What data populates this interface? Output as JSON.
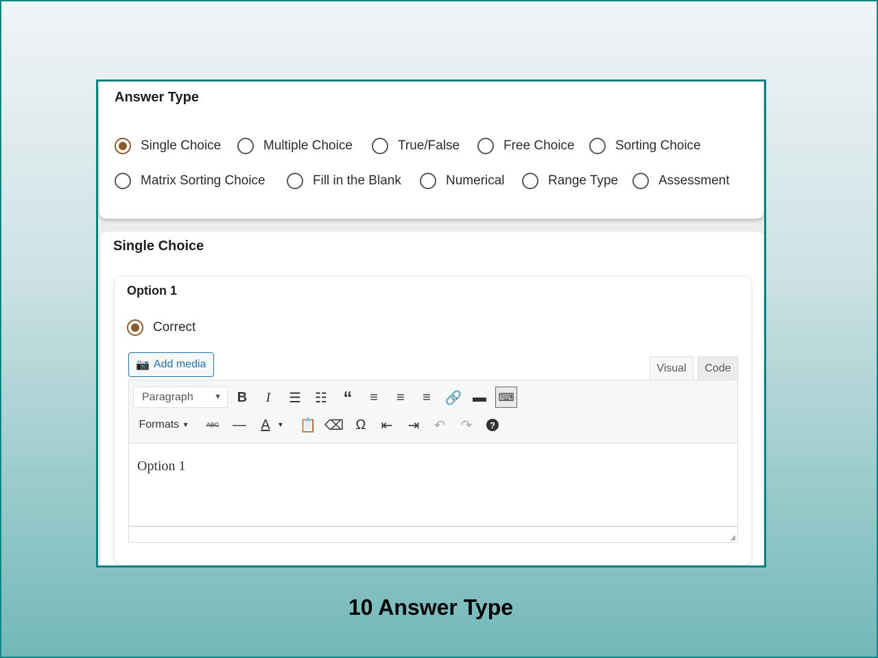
{
  "answer_type": {
    "title": "Answer Type",
    "options": [
      "Single Choice",
      "Multiple Choice",
      "True/False",
      "Free Choice",
      "Sorting Choice",
      "Matrix Sorting Choice",
      "Fill in the Blank",
      "Numerical",
      "Range Type",
      "Assessment"
    ],
    "selected": "Single Choice"
  },
  "section": {
    "title": "Single Choice"
  },
  "option": {
    "title": "Option 1",
    "correct_label": "Correct",
    "add_media": "Add media",
    "tabs": [
      "Visual",
      "Code"
    ],
    "paragraph": "Paragraph",
    "formats": "Formats",
    "content": "Option 1"
  },
  "caption": "10 Answer Type",
  "colors": {
    "accent": "#8a5a2b",
    "frame": "#0a8080",
    "link": "#2271b1"
  }
}
